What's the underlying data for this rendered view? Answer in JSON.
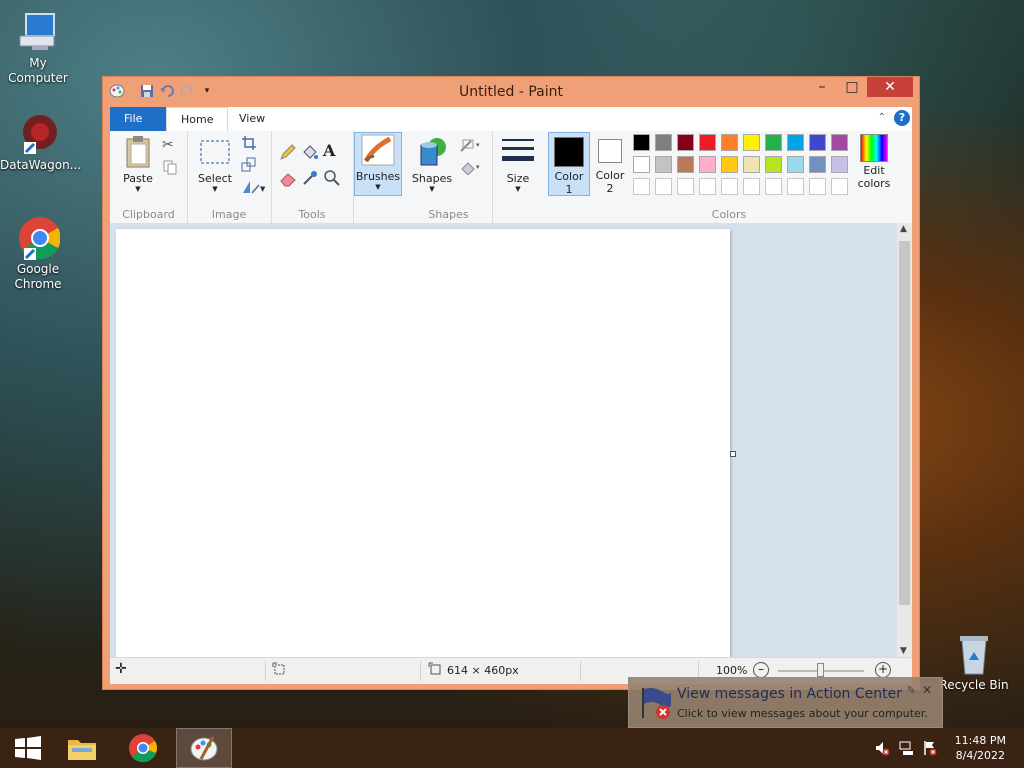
{
  "desktop": {
    "icons": [
      {
        "label": "My Computer"
      },
      {
        "label": "DataWagon..."
      },
      {
        "label": "Google Chrome"
      },
      {
        "label": "Recycle Bin"
      }
    ]
  },
  "window": {
    "title": "Untitled - Paint",
    "tabs": {
      "file": "File",
      "home": "Home",
      "view": "View"
    },
    "ribbon": {
      "clipboard": {
        "label": "Clipboard",
        "paste": "Paste"
      },
      "image": {
        "label": "Image",
        "select": "Select"
      },
      "tools": {
        "label": "Tools"
      },
      "brushes": {
        "label": "Brushes"
      },
      "shapes": {
        "label": "Shapes",
        "shapes_btn": "Shapes"
      },
      "size": {
        "label": "Size"
      },
      "colors": {
        "label": "Colors",
        "color1": "Color",
        "color1_num": "1",
        "color2": "Color",
        "color2_num": "2",
        "edit": "Edit",
        "edit2": "colors",
        "palette_row1": [
          "#000000",
          "#7f7f7f",
          "#880015",
          "#ed1c24",
          "#ff7f27",
          "#fff200",
          "#22b14c",
          "#00a2e8",
          "#3f48cc",
          "#a349a4"
        ],
        "palette_row2": [
          "#ffffff",
          "#c3c3c3",
          "#b97a57",
          "#ffaec9",
          "#ffc90e",
          "#efe4b0",
          "#b5e61d",
          "#99d9ea",
          "#7092be",
          "#c8bfe7"
        ],
        "palette_row3": [
          "#ffffff",
          "#ffffff",
          "#ffffff",
          "#ffffff",
          "#ffffff",
          "#ffffff",
          "#ffffff",
          "#ffffff",
          "#ffffff",
          "#ffffff"
        ],
        "color1_value": "#000000",
        "color2_value": "#ffffff"
      }
    },
    "status": {
      "canvas_size": "614 × 460px",
      "zoom": "100%"
    }
  },
  "notification": {
    "title": "View messages in Action Center",
    "body": "Click to view messages about your computer."
  },
  "taskbar": {
    "time": "11:48 PM",
    "date": "8/4/2022"
  }
}
